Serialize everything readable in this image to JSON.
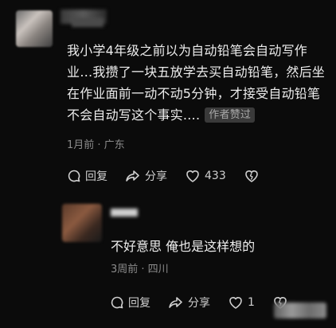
{
  "comment": {
    "text": "我小学4年级之前以为自动铅笔会自动写作业…我攒了一块五放学去买自动铅笔，然后坐在作业面前一动不动5分钟，才接受自动铅笔不会自动写这个事实….",
    "author_badge": "作者赞过",
    "meta": "1月前 · 广东",
    "actions": {
      "reply": "回复",
      "share": "分享",
      "likes": "433"
    }
  },
  "reply": {
    "text": "不好意思 俺也是这样想的",
    "meta": "3周前 · 四川",
    "actions": {
      "reply": "回复",
      "share": "分享",
      "likes": "1"
    }
  },
  "icons": {
    "reply": "reply-bubble-icon",
    "share": "share-arrow-icon",
    "like": "heart-icon",
    "dislike": "broken-heart-icon"
  }
}
